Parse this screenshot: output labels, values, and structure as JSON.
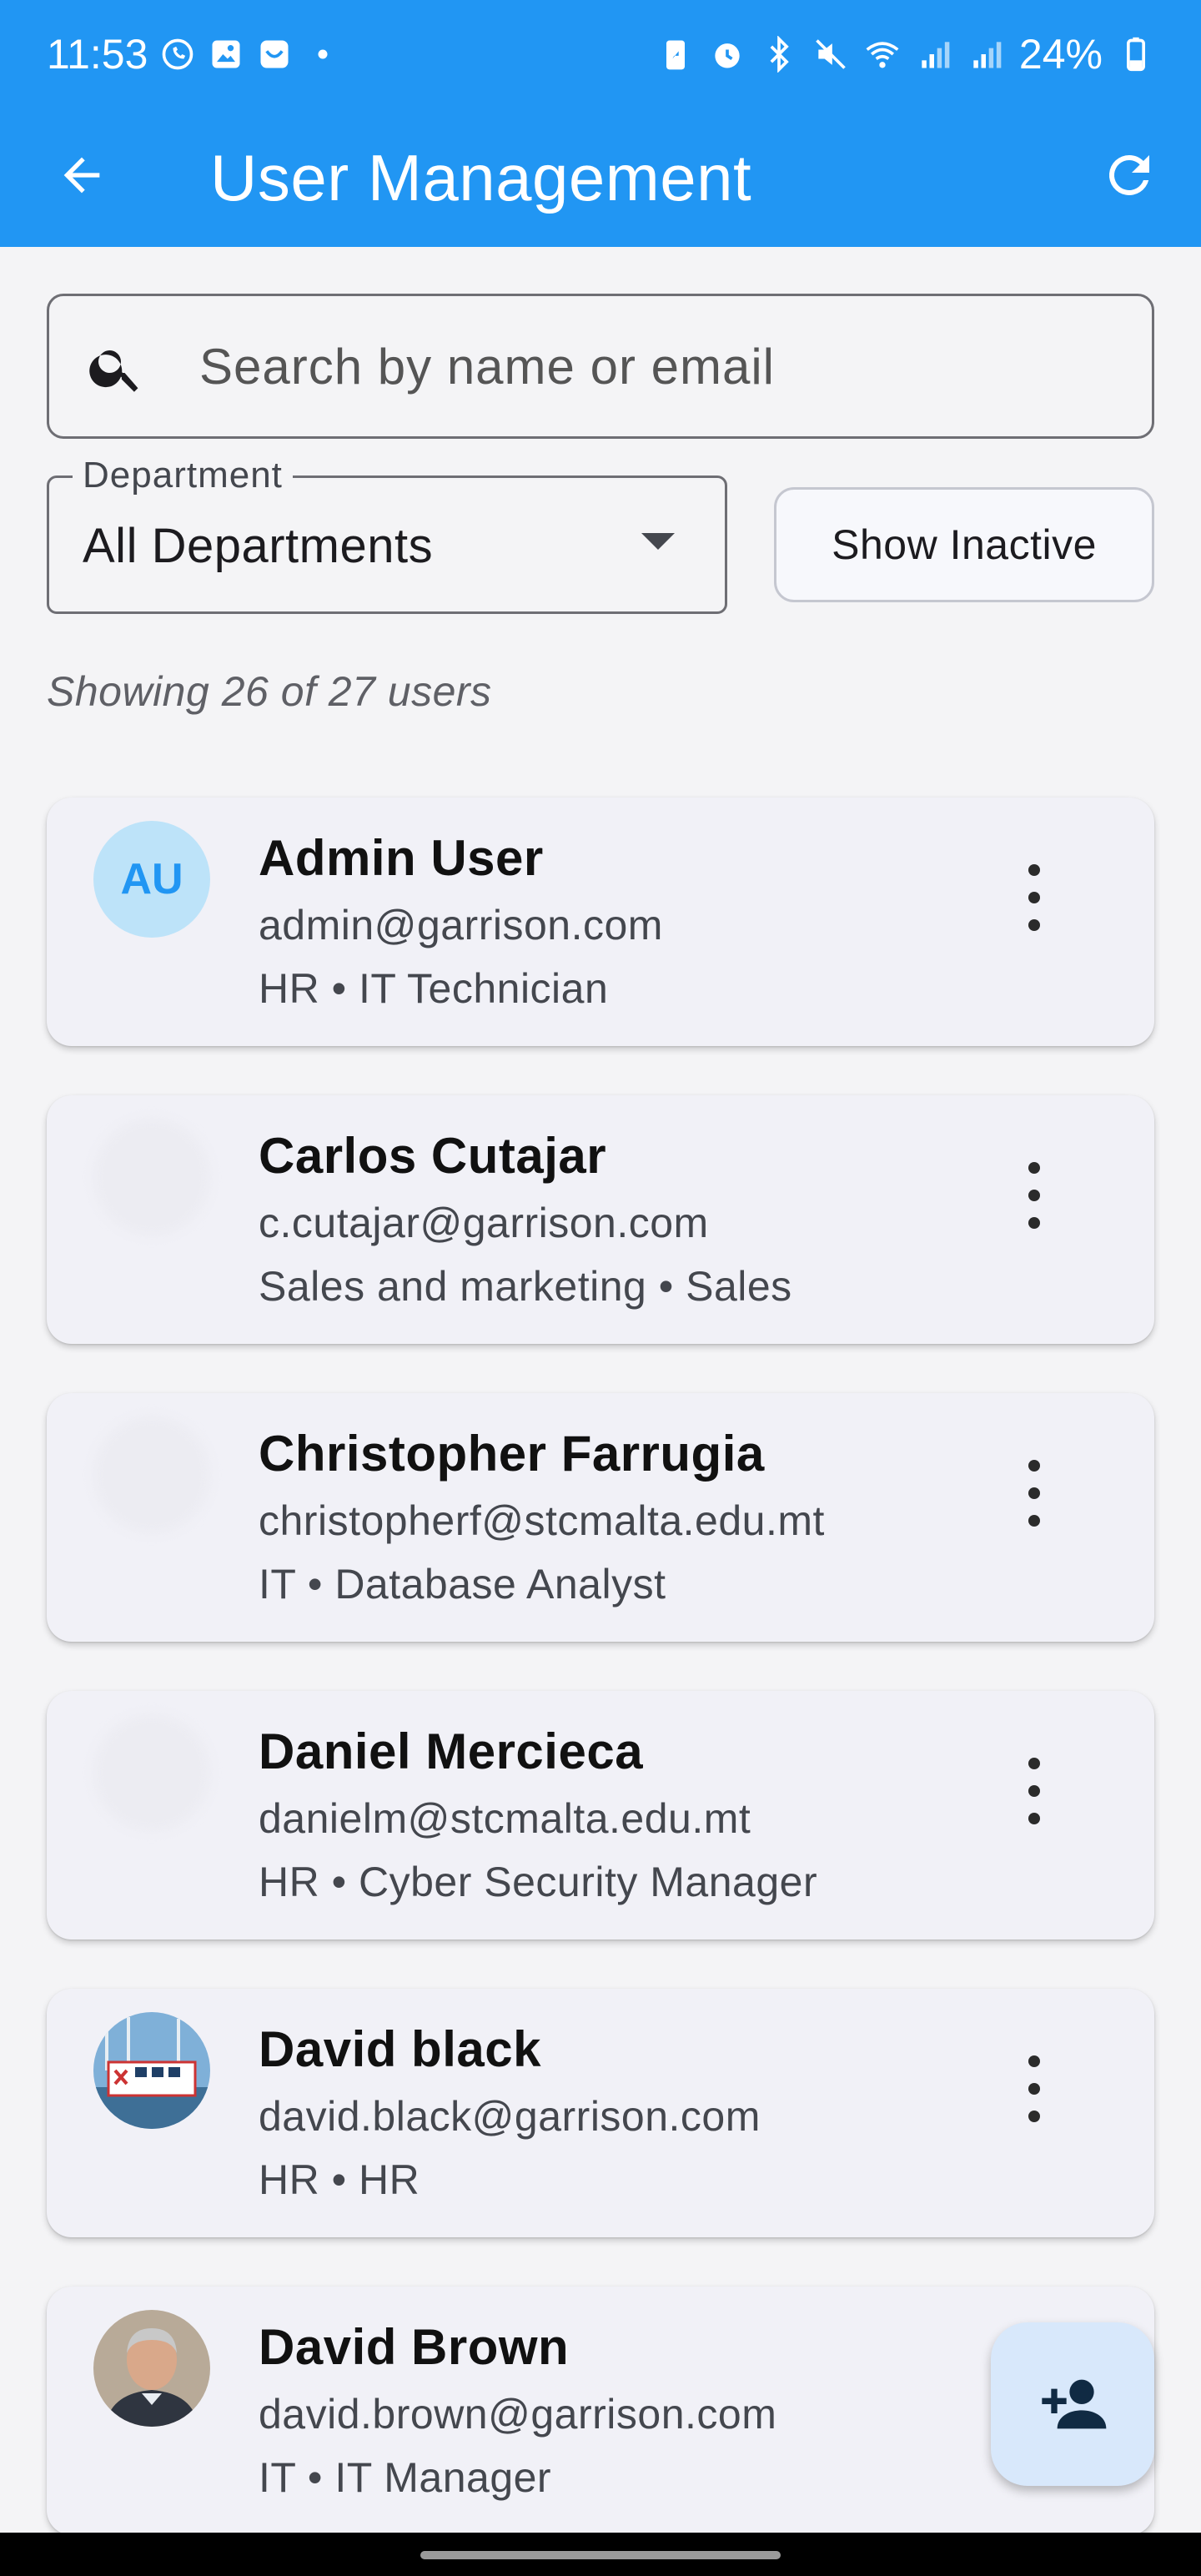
{
  "status_bar": {
    "time": "11:53",
    "battery": "24%",
    "left_icons": [
      "whatsapp-icon",
      "gallery-icon",
      "app-icon",
      "dot-icon"
    ],
    "right_icons": [
      "battery-saver-icon",
      "alarm-icon",
      "bluetooth-icon",
      "mute-icon",
      "wifi-icon",
      "signal-icon",
      "signal-icon-2",
      "battery-icon"
    ]
  },
  "header": {
    "title": "User Management",
    "back_icon": "arrow-back-icon",
    "refresh_icon": "refresh-icon"
  },
  "search": {
    "placeholder": "Search by name or email",
    "value": ""
  },
  "filters": {
    "department_label": "Department",
    "department_value": "All Departments",
    "show_inactive_label": "Show Inactive"
  },
  "summary": "Showing 26 of 27 users",
  "users": [
    {
      "name": "Admin User",
      "email": "admin@garrison.com",
      "meta": "HR • IT Technician",
      "initials": "AU",
      "avatar": "initials"
    },
    {
      "name": "Carlos Cutajar",
      "email": "c.cutajar@garrison.com",
      "meta": "Sales and marketing • Sales",
      "avatar": "loading"
    },
    {
      "name": "Christopher Farrugia",
      "email": "christopherf@stcmalta.edu.mt",
      "meta": "IT • Database Analyst",
      "avatar": "loading"
    },
    {
      "name": "Daniel Mercieca",
      "email": "danielm@stcmalta.edu.mt",
      "meta": "HR • Cyber Security Manager",
      "avatar": "loading"
    },
    {
      "name": "David black",
      "email": "david.black@garrison.com",
      "meta": "HR • HR",
      "avatar": "photo-boat"
    },
    {
      "name": "David Brown",
      "email": "david.brown@garrison.com",
      "meta": "IT • IT Manager",
      "avatar": "photo-man"
    }
  ],
  "fab_icon": "add-person-icon",
  "colors": {
    "primary": "#2196f3",
    "background": "#f4f4f6",
    "card": "#f1f1f7",
    "avatar_bg": "#bde3f9",
    "fab_bg": "#d8e8fb"
  }
}
